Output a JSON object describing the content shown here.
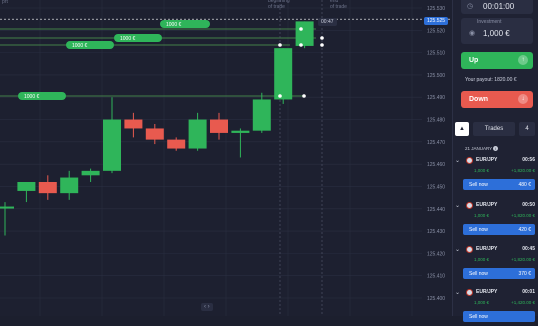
{
  "chart": {
    "price_ticks": [
      "125.530",
      "125.520",
      "125.510",
      "125.500",
      "125.490",
      "125.480",
      "125.470",
      "125.460",
      "125.450",
      "125.440",
      "125.430",
      "125.420",
      "125.410",
      "125.400"
    ],
    "current_price": "125.525",
    "top_labels": {
      "beginning": "beginning\nof trade",
      "end": "end\nof trade",
      "left": "prt"
    },
    "countdown": "00:47",
    "bet_tags": [
      "1000 €",
      "1000 €",
      "1000 €",
      "1000 €"
    ],
    "bottom_pager": "‹ ›",
    "colors": {
      "up": "#2fb55a",
      "down": "#e85a4f",
      "bg": "#1d2030",
      "grid": "#2a2e40",
      "guide": "#3a6f3a"
    }
  },
  "chart_data": {
    "type": "candlestick",
    "candles": [
      {
        "o": 125.441,
        "h": 125.443,
        "l": 125.428,
        "c": 125.441,
        "dir": "up"
      },
      {
        "o": 125.448,
        "h": 125.452,
        "l": 125.443,
        "c": 125.452,
        "dir": "up"
      },
      {
        "o": 125.452,
        "h": 125.455,
        "l": 125.444,
        "c": 125.447,
        "dir": "down"
      },
      {
        "o": 125.447,
        "h": 125.457,
        "l": 125.444,
        "c": 125.454,
        "dir": "up"
      },
      {
        "o": 125.455,
        "h": 125.458,
        "l": 125.452,
        "c": 125.457,
        "dir": "up"
      },
      {
        "o": 125.457,
        "h": 125.49,
        "l": 125.456,
        "c": 125.48,
        "dir": "up"
      },
      {
        "o": 125.48,
        "h": 125.483,
        "l": 125.472,
        "c": 125.476,
        "dir": "down"
      },
      {
        "o": 125.476,
        "h": 125.478,
        "l": 125.469,
        "c": 125.471,
        "dir": "down"
      },
      {
        "o": 125.471,
        "h": 125.472,
        "l": 125.466,
        "c": 125.467,
        "dir": "down"
      },
      {
        "o": 125.467,
        "h": 125.483,
        "l": 125.466,
        "c": 125.48,
        "dir": "up"
      },
      {
        "o": 125.48,
        "h": 125.483,
        "l": 125.471,
        "c": 125.474,
        "dir": "down"
      },
      {
        "o": 125.474,
        "h": 125.476,
        "l": 125.463,
        "c": 125.475,
        "dir": "up"
      },
      {
        "o": 125.475,
        "h": 125.492,
        "l": 125.474,
        "c": 125.489,
        "dir": "up"
      },
      {
        "o": 125.489,
        "h": 125.512,
        "l": 125.487,
        "c": 125.512,
        "dir": "up"
      },
      {
        "o": 125.513,
        "h": 125.524,
        "l": 125.512,
        "c": 125.524,
        "dir": "up"
      }
    ],
    "ylim": [
      125.4,
      125.53
    ],
    "grid": true
  },
  "panel": {
    "timer": "00:01:00",
    "investment_label": "Investment",
    "investment_value": "1,000 €",
    "up_label": "Up",
    "payout": "Your payout: 1820.00 €",
    "down_label": "Down",
    "trades_tab": "Trades",
    "trades_count": "4",
    "date": "21 JANUARY",
    "trades": [
      {
        "pair": "EUR/JPY",
        "time": "00:56",
        "amount": "1,000 €",
        "profit": "+1,820.00 €",
        "sell": "Sell now",
        "sell_val": "480 €"
      },
      {
        "pair": "EUR/JPY",
        "time": "00:50",
        "amount": "1,000 €",
        "profit": "+1,820.00 €",
        "sell": "Sell now",
        "sell_val": "420 €"
      },
      {
        "pair": "EUR/JPY",
        "time": "00:45",
        "amount": "1,000 €",
        "profit": "+1,820.00 €",
        "sell": "Sell now",
        "sell_val": "370 €"
      },
      {
        "pair": "EUR/JPY",
        "time": "00:01",
        "amount": "1,000 €",
        "profit": "+1,420.00 €",
        "sell": "Sell now",
        "sell_val": ""
      }
    ]
  }
}
